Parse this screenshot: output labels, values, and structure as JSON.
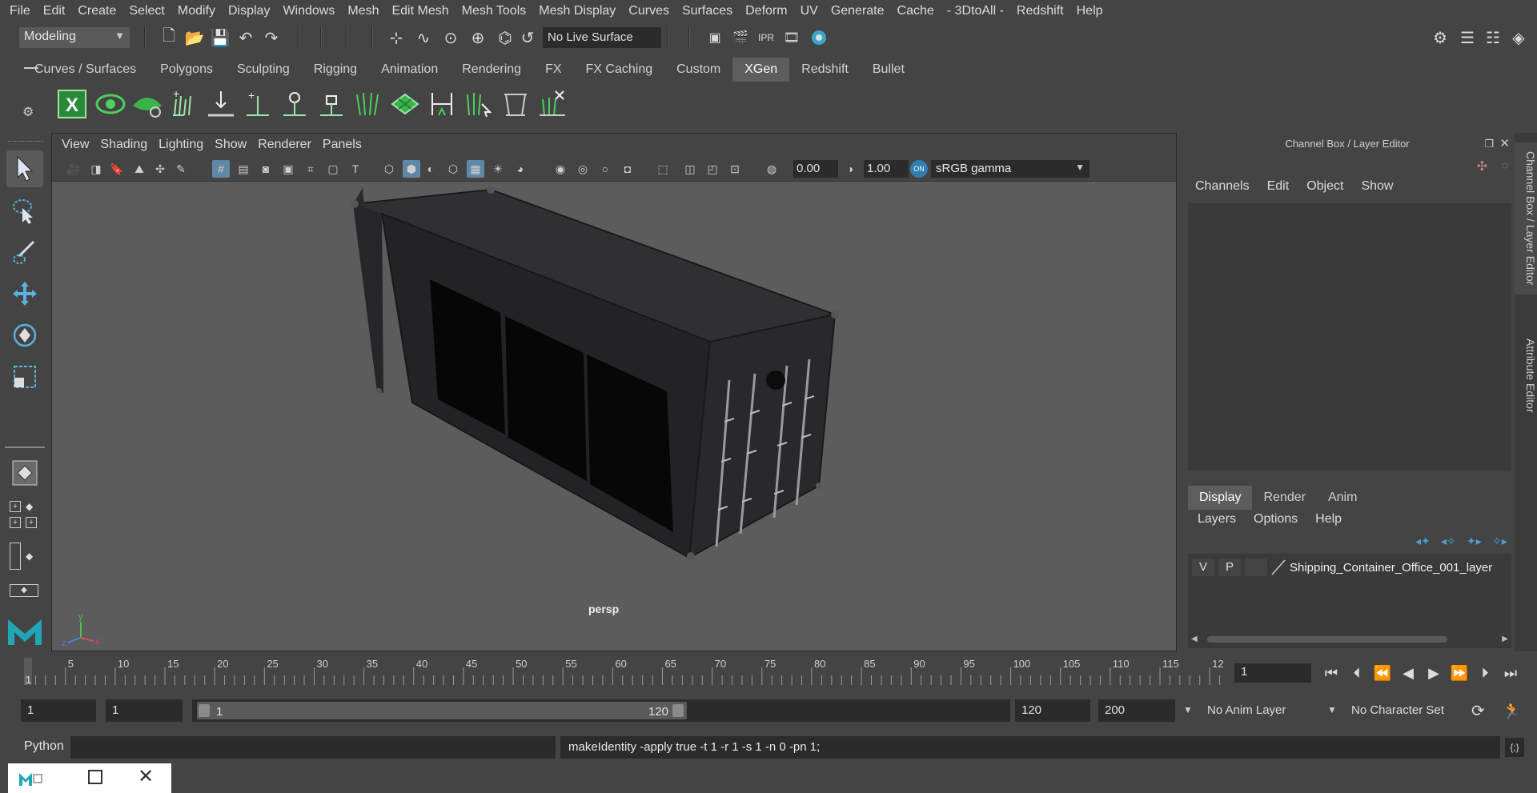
{
  "menubar": {
    "items": [
      "File",
      "Edit",
      "Create",
      "Select",
      "Modify",
      "Display",
      "Windows",
      "Mesh",
      "Edit Mesh",
      "Mesh Tools",
      "Mesh Display",
      "Curves",
      "Surfaces",
      "Deform",
      "UV",
      "Generate",
      "Cache",
      "- 3DtoAll -",
      "Redshift",
      "Help"
    ]
  },
  "statusline": {
    "mode": "Modeling",
    "live_surface": "No Live Surface"
  },
  "shelf": {
    "tabs": [
      "Curves / Surfaces",
      "Polygons",
      "Sculpting",
      "Rigging",
      "Animation",
      "Rendering",
      "FX",
      "FX Caching",
      "Custom",
      "XGen",
      "Redshift",
      "Bullet"
    ],
    "active_tab": "XGen"
  },
  "viewport": {
    "menus": [
      "View",
      "Shading",
      "Lighting",
      "Show",
      "Renderer",
      "Panels"
    ],
    "exposure": "0.00",
    "gamma": "1.00",
    "color_space": "sRGB gamma",
    "camera_label": "persp"
  },
  "channel_box": {
    "title": "Channel Box / Layer Editor",
    "menus": [
      "Channels",
      "Edit",
      "Object",
      "Show"
    ]
  },
  "layer_editor": {
    "tabs": [
      "Display",
      "Render",
      "Anim"
    ],
    "active_tab": "Display",
    "menus": [
      "Layers",
      "Options",
      "Help"
    ],
    "layer": {
      "v": "V",
      "p": "P",
      "name": "Shipping_Container_Office_001_layer"
    }
  },
  "side_tabs": [
    "Channel Box / Layer Editor",
    "Attribute Editor"
  ],
  "timeline": {
    "ticks": [
      "5",
      "10",
      "15",
      "20",
      "25",
      "30",
      "35",
      "40",
      "45",
      "50",
      "55",
      "60",
      "65",
      "70",
      "75",
      "80",
      "85",
      "90",
      "95",
      "100",
      "105",
      "110",
      "115",
      "12"
    ],
    "current_marker": "1",
    "current_frame": "1"
  },
  "range": {
    "start": "1",
    "playback_start": "1",
    "slider_start": "1",
    "slider_end": "120",
    "playback_end": "120",
    "end": "200",
    "anim_layer": "No Anim Layer",
    "character_set": "No Character Set"
  },
  "command": {
    "language": "Python",
    "output": "makeIdentity -apply true -t 1 -r 1 -s 1 -n 0 -pn 1;"
  },
  "colors": {
    "ui_bg": "#444444",
    "viewport_bg": "#5c5c5c",
    "accent_blue": "#5e88a6",
    "xgen_green": "#3bb34a"
  }
}
